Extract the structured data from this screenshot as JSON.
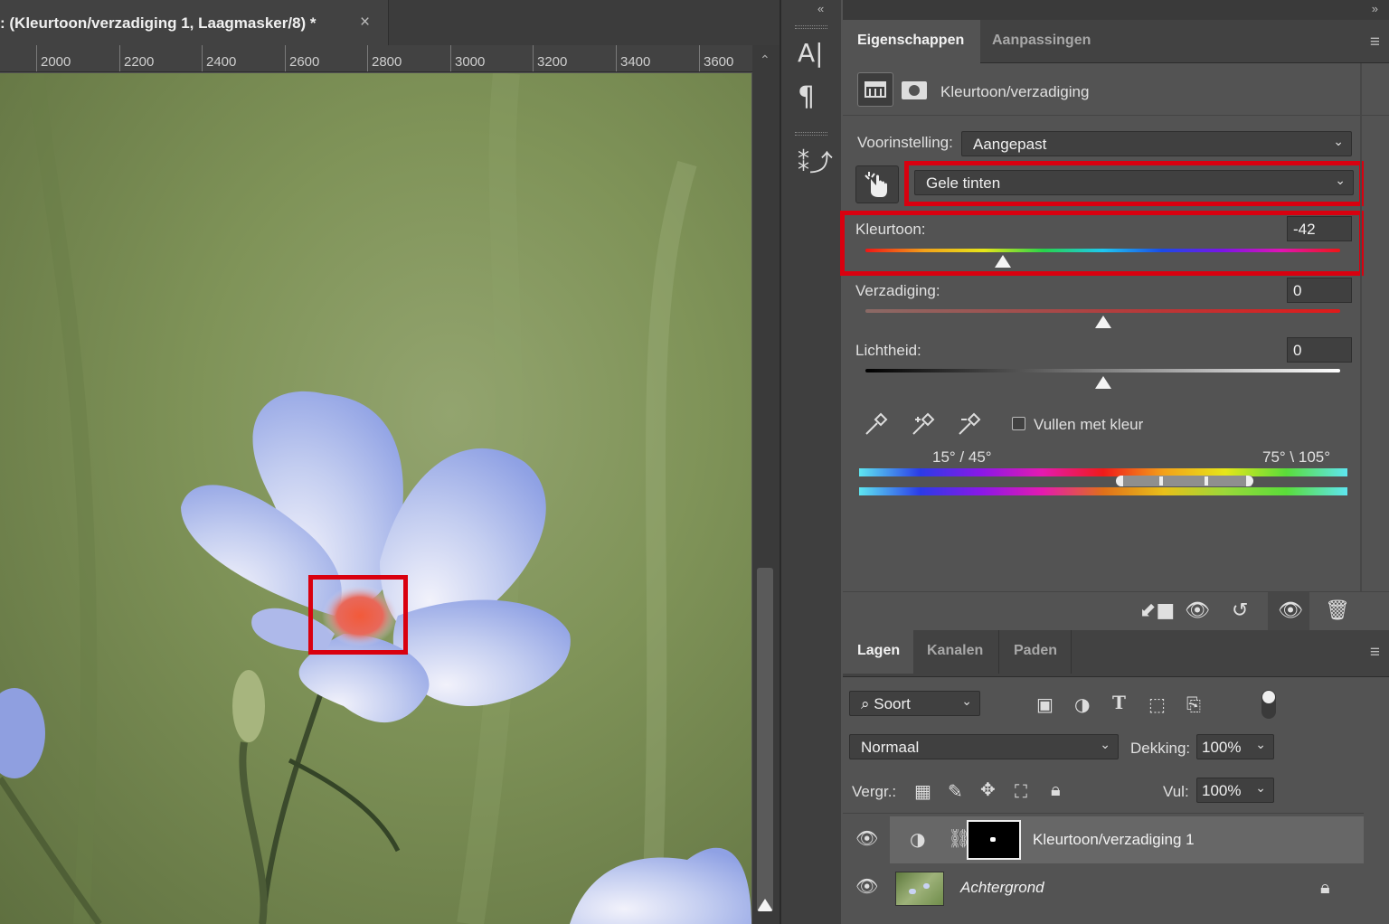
{
  "document": {
    "tab_title": ": (Kleurtoon/verzadiging 1, Laagmasker/8) *",
    "close": "×",
    "ruler_ticks": [
      "2000",
      "2200",
      "2400",
      "2600",
      "2800",
      "3000",
      "3200",
      "3400",
      "3600"
    ]
  },
  "toolstrip": {
    "char_icon": "A|",
    "para_icon": "¶",
    "glyph_icon": "glyph-panel-icon"
  },
  "properties": {
    "tabs": [
      "Eigenschappen",
      "Aanpassingen"
    ],
    "adjustment_name": "Kleurtoon/verzadiging",
    "preset_label": "Voorinstelling:",
    "preset_value": "Aangepast",
    "channel_value": "Gele tinten",
    "hue": {
      "label": "Kleurtoon:",
      "value": "-42",
      "position": 0.29
    },
    "saturation": {
      "label": "Verzadiging:",
      "value": "0",
      "position": 0.5
    },
    "lightness": {
      "label": "Lichtheid:",
      "value": "0",
      "position": 0.5
    },
    "colorize_label": "Vullen met kleur",
    "range_left": "15° / 45°",
    "range_right": "75° \\ 105°",
    "highlight_color": "#d9000f"
  },
  "layers": {
    "tabs": [
      "Lagen",
      "Kanalen",
      "Paden"
    ],
    "filter_value": "Soort",
    "blend_mode": "Normaal",
    "opacity_label": "Dekking:",
    "opacity_value": "100%",
    "lock_label": "Vergr.:",
    "fill_label": "Vul:",
    "fill_value": "100%",
    "items": [
      {
        "name": "Kleurtoon/verzadiging 1",
        "selected": true
      },
      {
        "name": "Achtergrond",
        "selected": false
      }
    ]
  }
}
